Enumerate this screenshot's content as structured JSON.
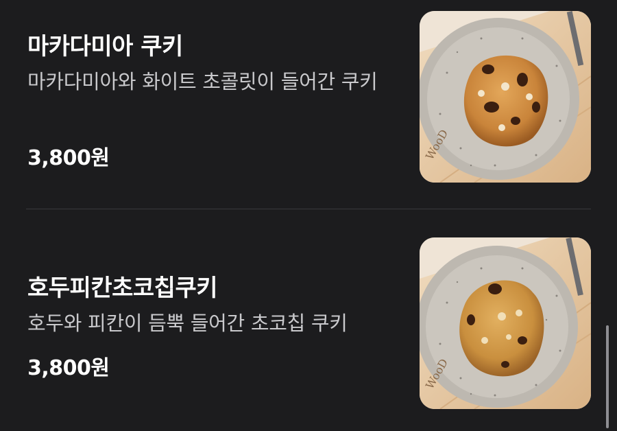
{
  "items": [
    {
      "name": "마카다미아 쿠키",
      "description": "마카다미아와 화이트 초콜릿이 들어간 쿠키",
      "price": "3,800원",
      "image_icon": "cookie-photo-icon"
    },
    {
      "name": "호두피칸초코칩쿠키",
      "description": "호두와 피칸이 듬뿍 들어간 초코칩 쿠키",
      "price": "3,800원",
      "image_icon": "cookie-photo-icon"
    }
  ],
  "colors": {
    "background": "#1c1c1e",
    "title": "#ffffff",
    "description": "#c9c9cc",
    "divider": "#3a3a3d",
    "scrollbar": "#8e8e93"
  }
}
